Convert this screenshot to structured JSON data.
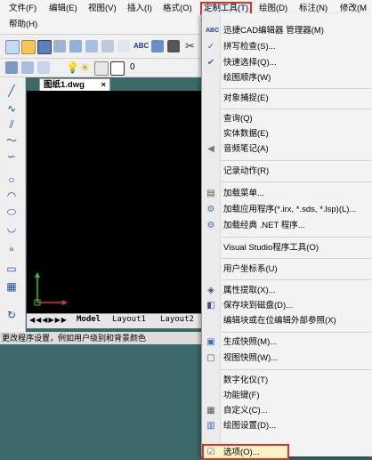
{
  "menubar": {
    "row1": [
      "文件(F)",
      "编辑(E)",
      "视图(V)",
      "插入(I)",
      "格式(O)",
      "定制工具(T)",
      "绘图(D)",
      "标注(N)",
      "修改(M"
    ],
    "row2": [
      "帮助(H)"
    ]
  },
  "toolbar": {
    "layer_value": "0"
  },
  "document_tab": "图纸1.dwg",
  "layout_tabs": [
    "Model",
    "Layout1",
    "Layout2"
  ],
  "status_text": "更改程序设置，例如用户级别和背景颜色",
  "menu": {
    "items": [
      {
        "label": "迅捷CAD编辑器 管理器(M)",
        "icon": "abc-icon"
      },
      {
        "label": "拼写检查(S)...",
        "icon": "spellcheck-icon"
      },
      {
        "label": "快速选择(Q)...",
        "icon": "quick-select-icon"
      },
      {
        "label": "绘图顺序(W)",
        "icon": ""
      },
      {
        "label": "对象捕捉(E)",
        "icon": ""
      },
      {
        "label": "查询(Q)",
        "icon": ""
      },
      {
        "label": "实体数据(E)",
        "icon": ""
      },
      {
        "label": "音频笔记(A)",
        "icon": "audio-icon"
      },
      {
        "label": "记录动作(R)",
        "icon": ""
      },
      {
        "label": "加载菜单...",
        "icon": "load-menu-icon"
      },
      {
        "label": "加载应用程序(*.irx, *.sds, *.lsp)(L)...",
        "icon": "gear-icon"
      },
      {
        "label": "加载经典 .NET 程序...",
        "icon": "gear-icon"
      },
      {
        "label": "Visual Studio程序工具(O)",
        "icon": ""
      },
      {
        "label": "用户坐标系(U)",
        "icon": ""
      },
      {
        "label": "属性提取(X)...",
        "icon": "attribute-icon"
      },
      {
        "label": "保存块到磁盘(D)...",
        "icon": "save-block-icon"
      },
      {
        "label": "编辑块或在位编辑外部参照(X)",
        "icon": ""
      },
      {
        "label": "生成快照(M)...",
        "icon": "snapshot-icon"
      },
      {
        "label": "视图快照(W)...",
        "icon": "view-snapshot-icon"
      },
      {
        "label": "数字化仪(T)",
        "icon": ""
      },
      {
        "label": "功能键(F)",
        "icon": ""
      },
      {
        "label": "自定义(C)...",
        "icon": "customize-icon"
      },
      {
        "label": "绘图设置(D)...",
        "icon": "draw-settings-icon"
      },
      {
        "label": "选项(O)...",
        "icon": "options-icon"
      }
    ]
  },
  "colors": {
    "highlight_border": "#d9322b",
    "canvas": "#000000",
    "background": "#3c6a68"
  }
}
